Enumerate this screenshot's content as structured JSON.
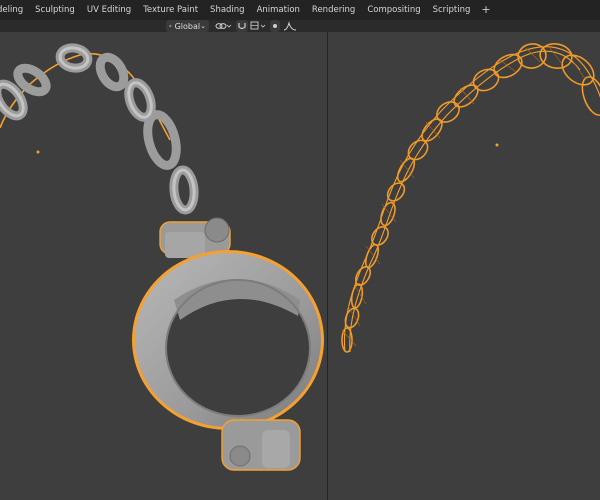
{
  "workspace_tabs": [
    {
      "label": "deling",
      "active": false
    },
    {
      "label": "Sculpting",
      "active": false
    },
    {
      "label": "UV Editing",
      "active": false
    },
    {
      "label": "Texture Paint",
      "active": false
    },
    {
      "label": "Shading",
      "active": false
    },
    {
      "label": "Animation",
      "active": false
    },
    {
      "label": "Rendering",
      "active": false
    },
    {
      "label": "Compositing",
      "active": false
    },
    {
      "label": "Scripting",
      "active": false
    }
  ],
  "add_tab_label": "+",
  "transform_orientation": {
    "value": "Global",
    "icon": "orientation-icon"
  },
  "icons": [
    "link-icon",
    "snap-icon",
    "proportional-edit-icon",
    "falloff-icon"
  ],
  "colors": {
    "selection_outline": "#f5a030",
    "mesh": "#9a9a9a",
    "viewport_bg": "#3e3e3e"
  }
}
